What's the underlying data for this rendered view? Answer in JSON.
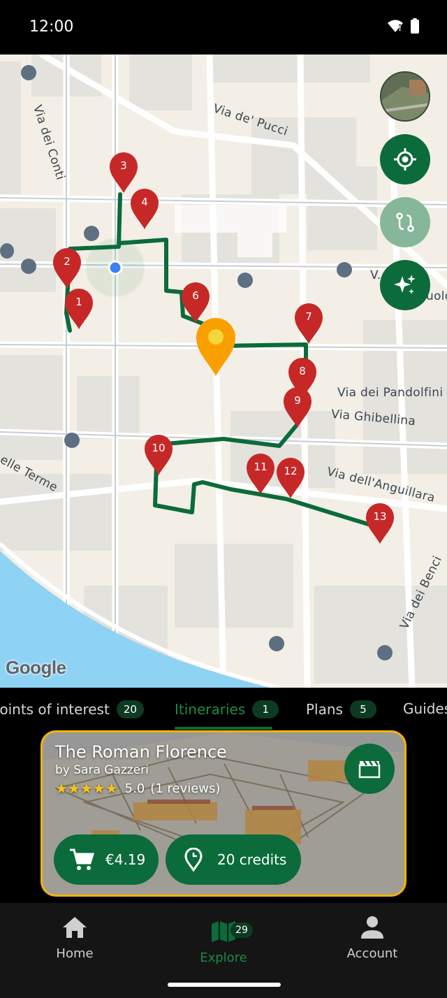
{
  "status_bar": {
    "time": "12:00"
  },
  "map": {
    "street_labels": [
      "Via de' Pucci",
      "Via dei Conti",
      "Via dei Pandolfini",
      "Via Ghibellina",
      "Via dell'Anguillara",
      "Via dei Benci",
      "elle Terme",
      "V.",
      "uolo"
    ],
    "attribution": "Google",
    "stops": [
      "3",
      "4",
      "2",
      "1",
      "6",
      "7",
      "8",
      "9",
      "10",
      "11",
      "12",
      "13"
    ],
    "colors": {
      "route": "#0b6b3a",
      "pin": "#c62828",
      "selected_pin": "#f9a000",
      "river": "#8fd3f4"
    }
  },
  "tabs": [
    {
      "label": "Points of interest",
      "count": "20"
    },
    {
      "label": "Itineraries",
      "count": "1"
    },
    {
      "label": "Plans",
      "count": "5"
    },
    {
      "label": "Guides",
      "count": ""
    }
  ],
  "card": {
    "title": "The Roman Florence",
    "author": "by Sara Gazzeri",
    "stars": "★★★★★",
    "rating": "5.0",
    "reviews": "(1 reviews)",
    "price": "€4.19",
    "credits": "20 credits"
  },
  "bottom_nav": {
    "home": "Home",
    "explore": "Explore",
    "explore_badge": "29",
    "account": "Account"
  }
}
